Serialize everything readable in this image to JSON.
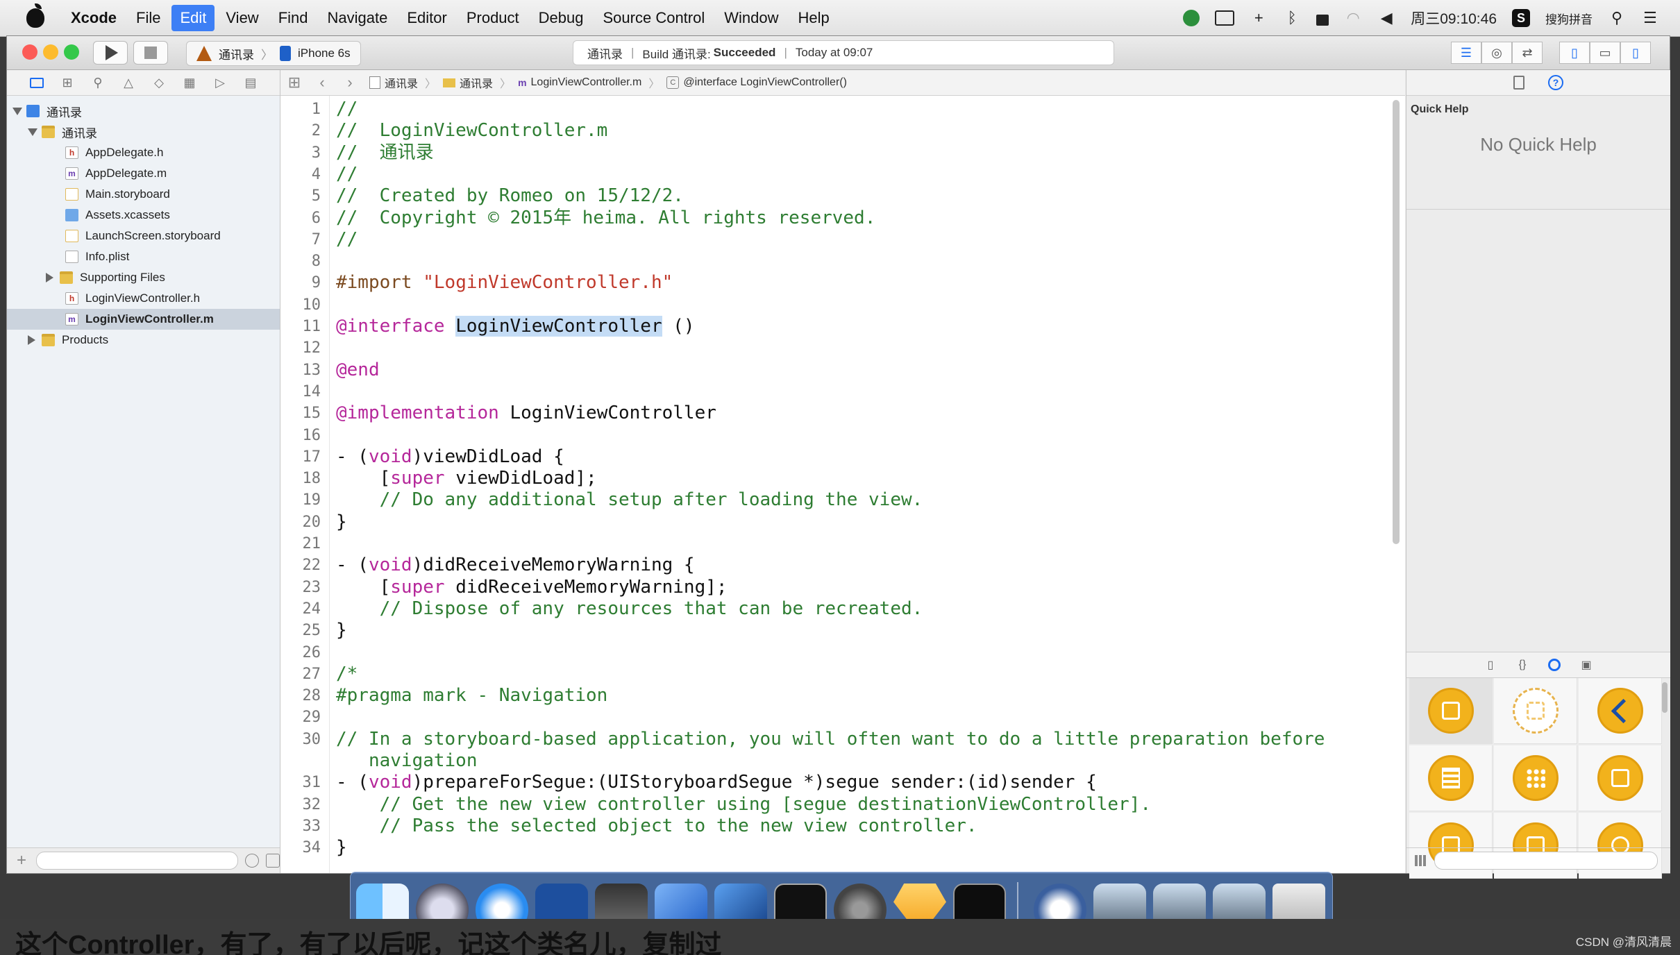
{
  "menubar": {
    "app": "Xcode",
    "items": [
      "File",
      "Edit",
      "View",
      "Find",
      "Navigate",
      "Editor",
      "Product",
      "Debug",
      "Source Control",
      "Window",
      "Help"
    ],
    "active_item": "Edit",
    "clock": "周三09:10:46",
    "input_method": "搜狗拼音"
  },
  "toolbar": {
    "scheme": "通讯录",
    "device": "iPhone 6s",
    "activity": {
      "project": "通讯录",
      "status_prefix": "Build 通讯录:",
      "status": "Succeeded",
      "time": "Today at 09:07"
    }
  },
  "navigator": {
    "rows": [
      {
        "label": "通讯录",
        "icon": "project-icon",
        "level": 0,
        "disclosure": "open"
      },
      {
        "label": "通讯录",
        "icon": "folder-icon",
        "level": 1,
        "disclosure": "open"
      },
      {
        "label": "AppDelegate.h",
        "icon": "header-file-icon",
        "level": 2
      },
      {
        "label": "AppDelegate.m",
        "icon": "objc-file-icon",
        "level": 2
      },
      {
        "label": "Main.storyboard",
        "icon": "storyboard-icon",
        "level": 2
      },
      {
        "label": "Assets.xcassets",
        "icon": "assets-icon",
        "level": 2
      },
      {
        "label": "LaunchScreen.storyboard",
        "icon": "storyboard-icon",
        "level": 2
      },
      {
        "label": "Info.plist",
        "icon": "plist-icon",
        "level": 2
      },
      {
        "label": "Supporting Files",
        "icon": "folder-icon",
        "level": 2,
        "disclosure": "closed"
      },
      {
        "label": "LoginViewController.h",
        "icon": "header-file-icon",
        "level": 2
      },
      {
        "label": "LoginViewController.m",
        "icon": "objc-file-icon",
        "level": 2,
        "selected": true
      },
      {
        "label": "Products",
        "icon": "folder-icon",
        "level": 1,
        "disclosure": "closed"
      }
    ]
  },
  "jumpbar": {
    "crumbs": [
      "通讯录",
      "通讯录",
      "LoginViewController.m",
      "@interface LoginViewController()"
    ]
  },
  "editor": {
    "line_numbers": [
      "1",
      "2",
      "3",
      "4",
      "5",
      "6",
      "7",
      "8",
      "9",
      "10",
      "11",
      "12",
      "13",
      "14",
      "15",
      "16",
      "17",
      "18",
      "19",
      "20",
      "21",
      "22",
      "23",
      "24",
      "25",
      "26",
      "27",
      "28",
      "29",
      "30",
      "31",
      "32",
      "33",
      "34"
    ],
    "lines": [
      "//",
      "//  LoginViewController.m",
      "//  通讯录",
      "//",
      "//  Created by Romeo on 15/12/2.",
      "//  Copyright © 2015年 heima. All rights reserved.",
      "//",
      "",
      "#import \"LoginViewController.h\"",
      "",
      "@interface LoginViewController ()",
      "",
      "@end",
      "",
      "@implementation LoginViewController",
      "",
      "- (void)viewDidLoad {",
      "    [super viewDidLoad];",
      "    // Do any additional setup after loading the view.",
      "}",
      "",
      "- (void)didReceiveMemoryWarning {",
      "    [super didReceiveMemoryWarning];",
      "    // Dispose of any resources that can be recreated.",
      "}",
      "",
      "/*",
      "#pragma mark - Navigation",
      "",
      "// In a storyboard-based application, you will often want to do a little preparation before",
      "   navigation",
      "- (void)prepareForSegue:(UIStoryboardSegue *)segue sender:(id)sender {",
      "    // Get the new view controller using [segue destinationViewController].",
      "    // Pass the selected object to the new view controller.",
      "}"
    ]
  },
  "utilities": {
    "quick_help_title": "Quick Help",
    "quick_help_empty": "No Quick Help"
  },
  "caption": {
    "text": "这个Controller，有了，有了以后呢，记这个类名儿，复制过",
    "watermark": "CSDN @清风清晨"
  }
}
